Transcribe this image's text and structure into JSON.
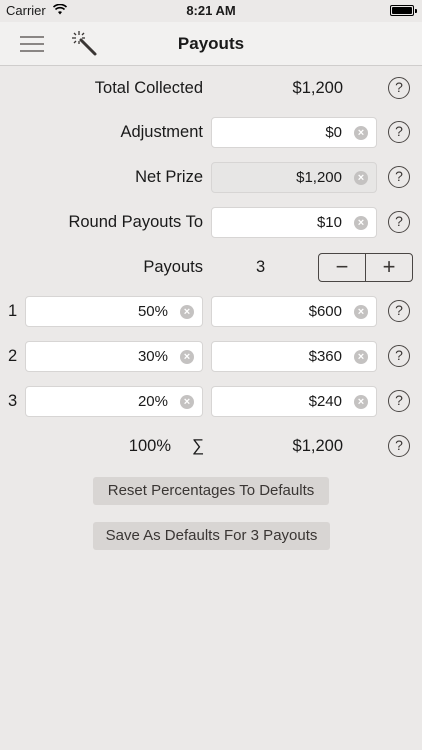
{
  "status_bar": {
    "carrier": "Carrier",
    "time": "8:21 AM"
  },
  "nav": {
    "title": "Payouts"
  },
  "rows": {
    "total_collected": {
      "label": "Total Collected",
      "value": "$1,200"
    },
    "adjustment": {
      "label": "Adjustment",
      "value": "$0"
    },
    "net_prize": {
      "label": "Net Prize",
      "value": "$1,200"
    },
    "round_to": {
      "label": "Round Payouts To",
      "value": "$10"
    },
    "payouts": {
      "label": "Payouts",
      "count": "3"
    }
  },
  "payout_rows": [
    {
      "index": "1",
      "percent": "50%",
      "amount": "$600"
    },
    {
      "index": "2",
      "percent": "30%",
      "amount": "$360"
    },
    {
      "index": "3",
      "percent": "20%",
      "amount": "$240"
    }
  ],
  "totals": {
    "percent": "100%",
    "sigma": "∑",
    "amount": "$1,200"
  },
  "buttons": {
    "reset": "Reset Percentages To Defaults",
    "save": "Save As Defaults For 3 Payouts"
  },
  "icons": {
    "help": "?",
    "clear": "×",
    "minus": "−",
    "plus": "+"
  }
}
